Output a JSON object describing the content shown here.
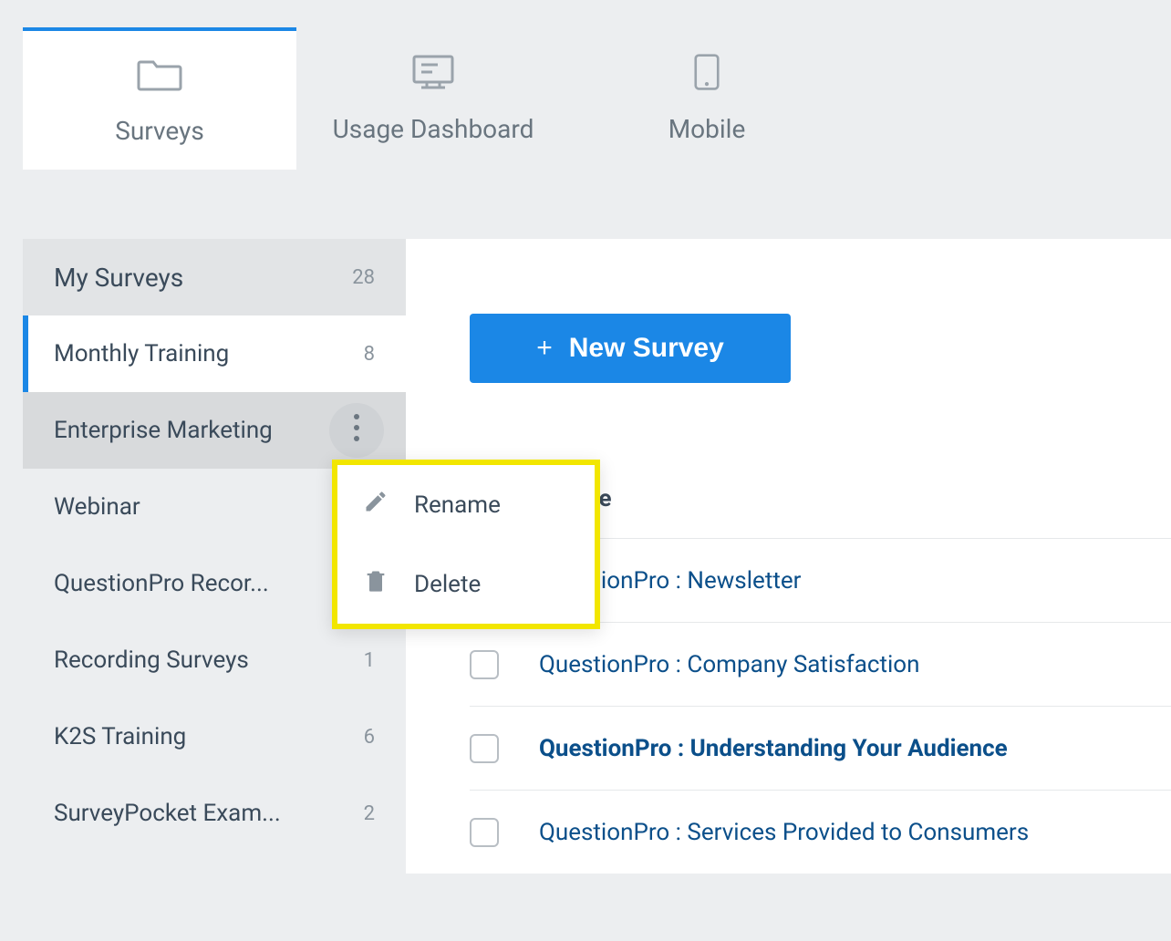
{
  "tabs": {
    "surveys": "Surveys",
    "usage": "Usage Dashboard",
    "mobile": "Mobile"
  },
  "sidebar": {
    "header_label": "My Surveys",
    "header_count": "28",
    "items": [
      {
        "label": "Monthly Training",
        "count": "8"
      },
      {
        "label": "Enterprise Marketing",
        "count": ""
      },
      {
        "label": "Webinar",
        "count": ""
      },
      {
        "label": "QuestionPro Recor...",
        "count": ""
      },
      {
        "label": "Recording Surveys",
        "count": "1"
      },
      {
        "label": "K2S Training",
        "count": "6"
      },
      {
        "label": "SurveyPocket Exam...",
        "count": "2"
      }
    ]
  },
  "context_menu": {
    "rename": "Rename",
    "delete": "Delete"
  },
  "main": {
    "new_survey": "New Survey",
    "column_header": "Survey Name",
    "rows": [
      {
        "name": "QuestionPro : Newsletter",
        "bold": false
      },
      {
        "name": "QuestionPro : Company Satisfaction",
        "bold": false
      },
      {
        "name": "QuestionPro : Understanding Your Audience",
        "bold": true
      },
      {
        "name": "QuestionPro : Services Provided to Consumers",
        "bold": false
      }
    ]
  }
}
